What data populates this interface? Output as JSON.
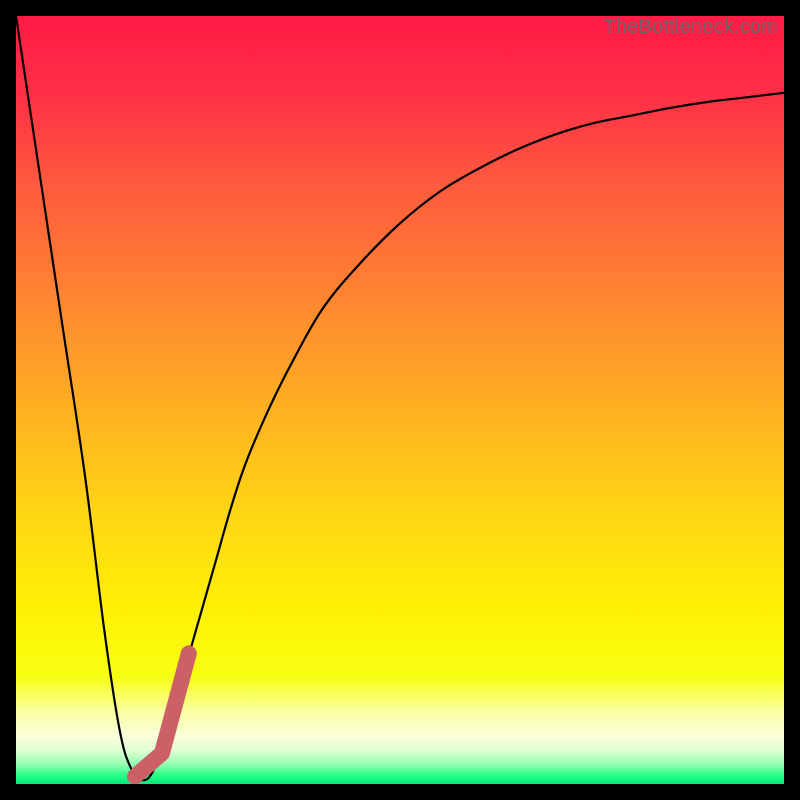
{
  "watermark": "TheBottleneck.com",
  "colors": {
    "black": "#000000",
    "curve": "#000000",
    "highlight": "#cb6167",
    "gradient_stops": [
      {
        "offset": 0.0,
        "color": "#ff1b45"
      },
      {
        "offset": 0.1,
        "color": "#ff2f46"
      },
      {
        "offset": 0.22,
        "color": "#ff5a3e"
      },
      {
        "offset": 0.35,
        "color": "#ff8033"
      },
      {
        "offset": 0.5,
        "color": "#ffad23"
      },
      {
        "offset": 0.65,
        "color": "#ffd613"
      },
      {
        "offset": 0.78,
        "color": "#fff205"
      },
      {
        "offset": 0.86,
        "color": "#f8ff12"
      },
      {
        "offset": 0.905,
        "color": "#faffa0"
      },
      {
        "offset": 0.935,
        "color": "#fbffd8"
      },
      {
        "offset": 0.955,
        "color": "#e6ffd4"
      },
      {
        "offset": 0.975,
        "color": "#90ffb0"
      },
      {
        "offset": 0.99,
        "color": "#1dff84"
      },
      {
        "offset": 1.0,
        "color": "#06e97a"
      }
    ]
  },
  "chart_data": {
    "type": "line",
    "title": "",
    "xlabel": "",
    "ylabel": "",
    "xlim": [
      0,
      100
    ],
    "ylim": [
      0,
      100
    ],
    "grid": false,
    "series": [
      {
        "name": "bottleneck-curve",
        "x": [
          0,
          3,
          6,
          9,
          11.5,
          13.5,
          15,
          16.5,
          18,
          20,
          22,
          24,
          26,
          28,
          30,
          33,
          36,
          40,
          45,
          50,
          55,
          60,
          65,
          70,
          75,
          80,
          85,
          90,
          95,
          100
        ],
        "values": [
          100,
          80,
          60,
          40,
          20,
          7,
          2,
          0.5,
          2,
          8,
          15,
          22,
          29,
          36,
          42,
          49,
          55,
          62,
          68,
          73,
          77,
          80,
          82.5,
          84.5,
          86,
          87,
          88,
          88.8,
          89.4,
          90
        ]
      },
      {
        "name": "highlight-segment",
        "x": [
          15.5,
          19.0,
          22.5
        ],
        "values": [
          1.0,
          4.0,
          17.0
        ]
      }
    ],
    "annotations": []
  }
}
